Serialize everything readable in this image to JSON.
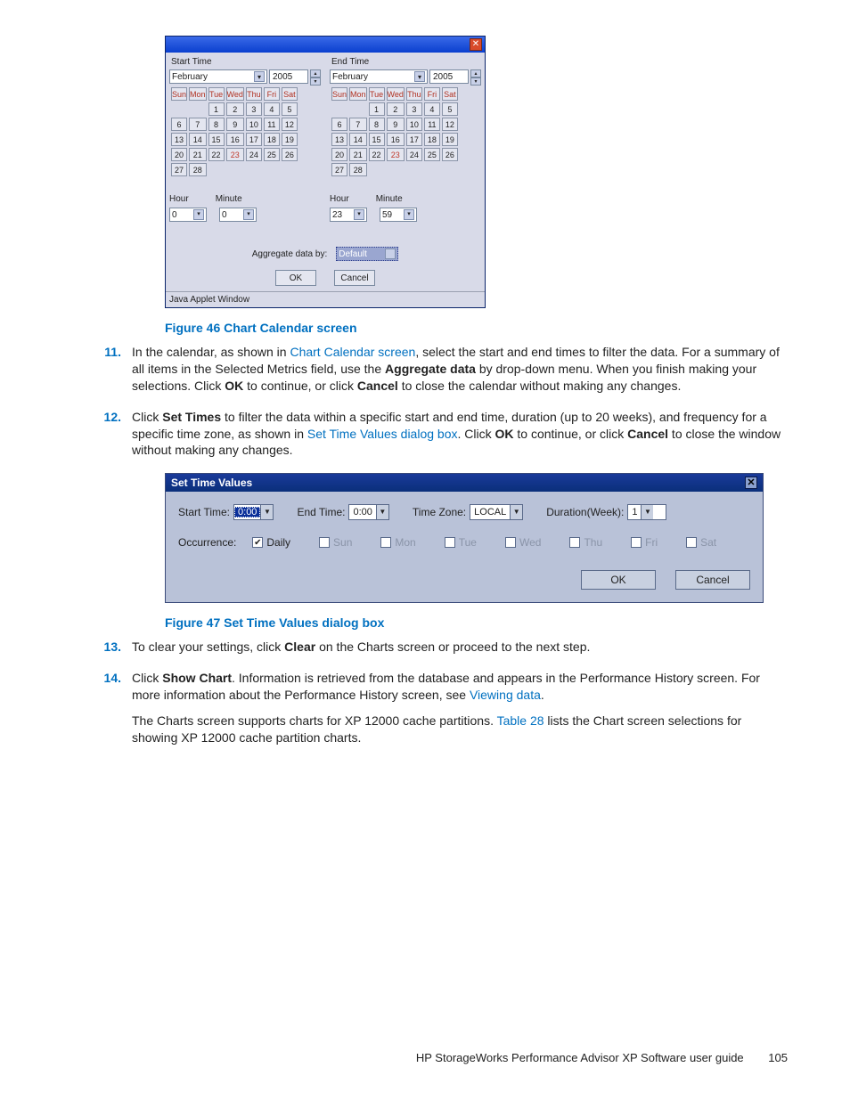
{
  "fig46": {
    "startLabel": "Start Time",
    "endLabel": "End Time",
    "month": "February",
    "year": "2005",
    "days": [
      "Sun",
      "Mon",
      "Tue",
      "Wed",
      "Thu",
      "Fri",
      "Sat"
    ],
    "selectedDay": 23,
    "hourLabel": "Hour",
    "minuteLabel": "Minute",
    "start": {
      "hour": "0",
      "minute": "0"
    },
    "end": {
      "hour": "23",
      "minute": "59"
    },
    "aggLabel": "Aggregate data by:",
    "aggValue": "Default",
    "ok": "OK",
    "cancel": "Cancel",
    "status": "Java Applet Window"
  },
  "captions": {
    "fig46": "Figure 46 Chart Calendar screen",
    "fig47": "Figure 47 Set Time Values dialog box"
  },
  "steps": {
    "s11": {
      "num": "11.",
      "pre": "In the calendar, as shown in ",
      "link": "Chart Calendar screen",
      "post1": ", select the start and end times to filter the data. For a summary of all items in the Selected Metrics field, use the ",
      "bold1": "Aggregate data",
      "post2": " by drop-down menu. When you finish making your selections. Click ",
      "bold2": "OK",
      "post3": " to continue, or click ",
      "bold3": "Cancel",
      "post4": " to close the calendar without making any changes."
    },
    "s12": {
      "num": "12.",
      "pre": "Click ",
      "bold1": "Set Times",
      "mid1": " to filter the data within a specific start and end time, duration (up to 20 weeks), and frequency for a specific time zone, as shown in ",
      "link": "Set Time Values dialog box",
      "mid2": ". Click ",
      "bold2": "OK",
      "mid3": " to continue, or click ",
      "bold3": "Cancel",
      "mid4": " to close the window without making any changes."
    },
    "s13": {
      "num": "13.",
      "pre": "To clear your settings, click ",
      "bold1": "Clear",
      "post": " on the Charts screen or proceed to the next step."
    },
    "s14": {
      "num": "14.",
      "pre": "Click ",
      "bold1": "Show Chart",
      "mid": ". Information is retrieved from the database and appears in the Performance History screen. For more information about the Performance History screen, see ",
      "link": "Viewing data",
      "post": ".",
      "para2a": "The Charts screen supports charts for XP 12000 cache partitions. ",
      "para2link": "Table 28",
      "para2b": " lists the Chart screen selections for showing XP 12000 cache partition charts."
    }
  },
  "fig47": {
    "title": "Set Time Values",
    "startLabel": "Start Time:",
    "startVal": "0:00",
    "endLabel": "End Time:",
    "endVal": "0:00",
    "tzLabel": "Time Zone:",
    "tzVal": "LOCAL",
    "durLabel": "Duration(Week):",
    "durVal": "1",
    "occLabel": "Occurrence:",
    "daily": "Daily",
    "days": [
      "Sun",
      "Mon",
      "Tue",
      "Wed",
      "Thu",
      "Fri",
      "Sat"
    ],
    "ok": "OK",
    "cancel": "Cancel"
  },
  "footer": {
    "text": "HP StorageWorks Performance Advisor XP Software user guide",
    "page": "105"
  }
}
